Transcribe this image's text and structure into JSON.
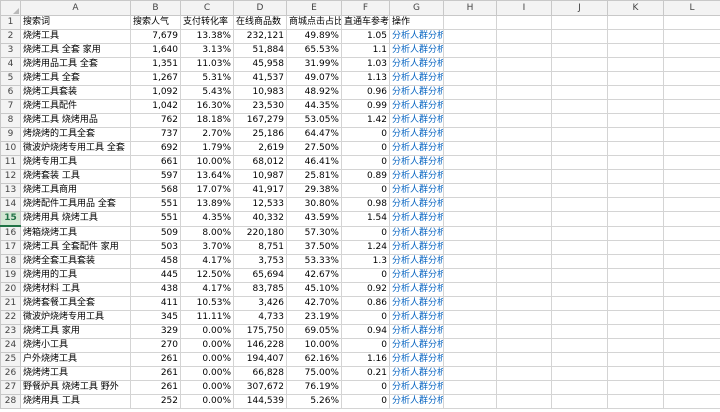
{
  "columns": [
    "A",
    "B",
    "C",
    "D",
    "E",
    "F",
    "G",
    "H",
    "I",
    "J",
    "K",
    "L"
  ],
  "header": [
    "搜索词",
    "搜索人气",
    "支付转化率",
    "在线商品数",
    "商城点击占比",
    "直通车参考价",
    "操作"
  ],
  "active_row": 15,
  "rows": [
    [
      "烧烤工具",
      "7,679",
      "13.38%",
      "232,121",
      "49.89%",
      "1.05",
      "分析人群分析"
    ],
    [
      "烧烤工具 全套 家用",
      "1,640",
      "3.13%",
      "51,884",
      "65.53%",
      "1.1",
      "分析人群分析"
    ],
    [
      "烧烤用品工具 全套",
      "1,351",
      "11.03%",
      "45,958",
      "31.99%",
      "1.03",
      "分析人群分析"
    ],
    [
      "烧烤工具 全套",
      "1,267",
      "5.31%",
      "41,537",
      "49.07%",
      "1.13",
      "分析人群分析"
    ],
    [
      "烧烤工具套装",
      "1,092",
      "5.43%",
      "10,983",
      "48.92%",
      "0.96",
      "分析人群分析"
    ],
    [
      "烧烤工具配件",
      "1,042",
      "16.30%",
      "23,530",
      "44.35%",
      "0.99",
      "分析人群分析"
    ],
    [
      "烧烤工具 烧烤用品",
      "762",
      "18.18%",
      "167,279",
      "53.05%",
      "1.42",
      "分析人群分析"
    ],
    [
      "烤烧烤的工具全套",
      "737",
      "2.70%",
      "25,186",
      "64.47%",
      "0",
      "分析人群分析"
    ],
    [
      "微波炉烧烤专用工具 全套",
      "692",
      "1.79%",
      "2,619",
      "27.50%",
      "0",
      "分析人群分析"
    ],
    [
      "烧烤专用工具",
      "661",
      "10.00%",
      "68,012",
      "46.41%",
      "0",
      "分析人群分析"
    ],
    [
      "烧烤套装 工具",
      "597",
      "13.64%",
      "10,987",
      "25.81%",
      "0.89",
      "分析人群分析"
    ],
    [
      "烧烤工具商用",
      "568",
      "17.07%",
      "41,917",
      "29.38%",
      "0",
      "分析人群分析"
    ],
    [
      "烧烤配件工具用品 全套",
      "551",
      "13.89%",
      "12,533",
      "30.80%",
      "0.98",
      "分析人群分析"
    ],
    [
      "烧烤用具 烧烤工具",
      "551",
      "4.35%",
      "40,332",
      "43.59%",
      "1.54",
      "分析人群分析"
    ],
    [
      "烤箱烧烤工具",
      "509",
      "8.00%",
      "220,180",
      "57.30%",
      "0",
      "分析人群分析"
    ],
    [
      "烧烤工具 全套配件 家用",
      "503",
      "3.70%",
      "8,751",
      "37.50%",
      "1.24",
      "分析人群分析"
    ],
    [
      "烧烤全套工具套装",
      "458",
      "4.17%",
      "3,753",
      "53.33%",
      "1.3",
      "分析人群分析"
    ],
    [
      "烧烤用的工具",
      "445",
      "12.50%",
      "65,694",
      "42.67%",
      "0",
      "分析人群分析"
    ],
    [
      "烧烤材料 工具",
      "438",
      "4.17%",
      "83,785",
      "45.10%",
      "0.92",
      "分析人群分析"
    ],
    [
      "烧烤套餐工具全套",
      "411",
      "10.53%",
      "3,426",
      "42.70%",
      "0.86",
      "分析人群分析"
    ],
    [
      "微波炉烧烤专用工具",
      "345",
      "11.11%",
      "4,733",
      "23.19%",
      "0",
      "分析人群分析"
    ],
    [
      "烧烤工具 家用",
      "329",
      "0.00%",
      "175,750",
      "69.05%",
      "0.94",
      "分析人群分析"
    ],
    [
      "烧烤小工具",
      "270",
      "0.00%",
      "146,228",
      "10.00%",
      "0",
      "分析人群分析"
    ],
    [
      "户外烧烤工具",
      "261",
      "0.00%",
      "194,407",
      "62.16%",
      "1.16",
      "分析人群分析"
    ],
    [
      "烧烤烤工具",
      "261",
      "0.00%",
      "66,828",
      "75.00%",
      "0.21",
      "分析人群分析"
    ],
    [
      "野餐炉具 烧烤工具 野外",
      "261",
      "0.00%",
      "307,672",
      "76.19%",
      "0",
      "分析人群分析"
    ],
    [
      "烧烤用具 工具",
      "252",
      "0.00%",
      "144,539",
      "5.26%",
      "0",
      "分析人群分析"
    ]
  ]
}
